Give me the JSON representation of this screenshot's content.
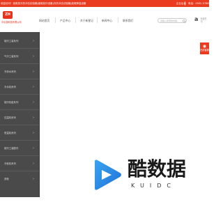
{
  "topbar": {
    "welcome": "欢迎访问！液氮泵冷热冲击实验箱|液氮制冷设备|冷热冲击试验箱|液氮降温设备",
    "control_panel": "企业后台",
    "tel": "电话：0592-578869(15710060"
  },
  "header": {
    "logo_badge": "ZH",
    "logo_text": "中氦源科技有限公司",
    "nav": [
      "网站首页",
      "产品中心",
      "关于新星记",
      "新闻中心",
      "联系我们"
    ],
    "search_placeholder": "请输入搜索的内容...",
    "brand_mark": "a",
    "brand_mark_text": "阿里巴巴"
  },
  "sidebar": {
    "items": [
      {
        "label": "制冷工装系列"
      },
      {
        "label": "气冷工装系列"
      },
      {
        "label": "冷却水系列"
      },
      {
        "label": "冷水机系列"
      },
      {
        "label": "制冷机组系列"
      },
      {
        "label": "控温机系列"
      },
      {
        "label": "恒温机系列"
      },
      {
        "label": "制冷工装配件"
      },
      {
        "label": "冷柜机系列"
      },
      {
        "label": "其他"
      }
    ]
  },
  "float_button": {
    "icon": "chat-bubble-icon",
    "label": "在线客服"
  },
  "watermark": {
    "title": "酷数据",
    "subtitle": "KUIDC"
  },
  "colors": {
    "accent": "#ea3a1f",
    "sidebar": "#4a4a4a"
  }
}
